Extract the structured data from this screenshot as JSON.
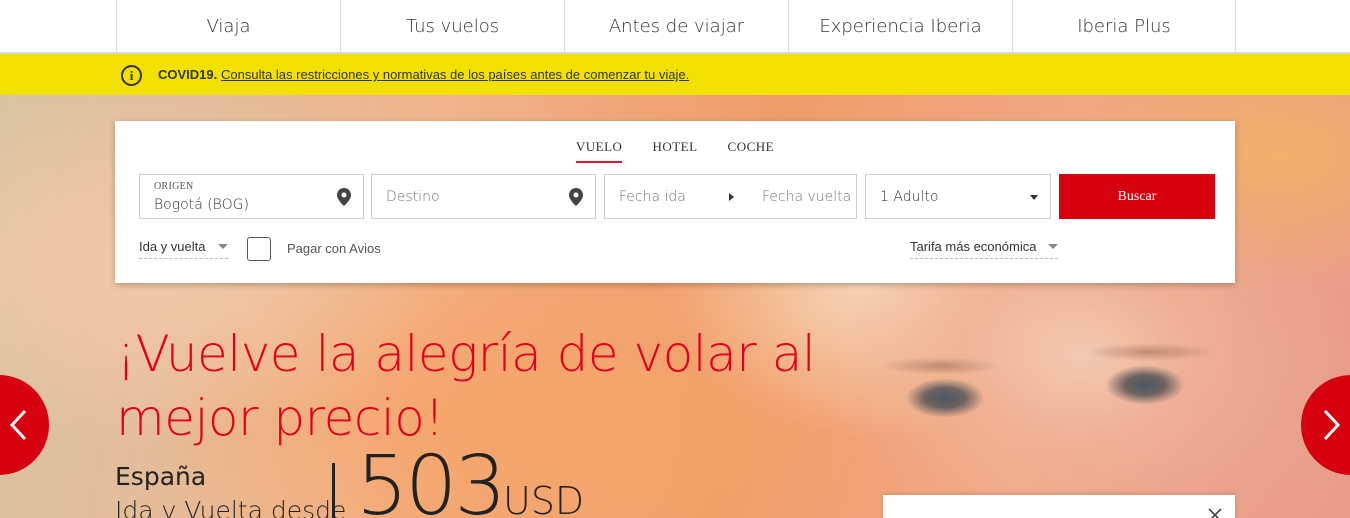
{
  "nav": {
    "items": [
      {
        "label": "Viaja"
      },
      {
        "label": "Tus vuelos"
      },
      {
        "label": "Antes de viajar"
      },
      {
        "label": "Experiencia Iberia"
      },
      {
        "label": "Iberia Plus"
      }
    ]
  },
  "covid": {
    "label": "COVID19.",
    "link": "Consulta las restricciones y normativas de los países antes de comenzar tu viaje.",
    "icon": "info-icon"
  },
  "search": {
    "tabs": [
      {
        "label": "VUELO",
        "active": true
      },
      {
        "label": "HOTEL",
        "active": false
      },
      {
        "label": "COCHE",
        "active": false
      }
    ],
    "origin": {
      "label": "ORIGEN",
      "value": "Bogotá (BOG)"
    },
    "destination": {
      "placeholder": "Destino"
    },
    "dates": {
      "departure_placeholder": "Fecha ida",
      "return_placeholder": "Fecha vuelta"
    },
    "passengers": {
      "value": "1 Adulto"
    },
    "search_button": "Buscar",
    "trip_type": "Ida y vuelta",
    "avios_label": "Pagar con Avios",
    "fare": "Tarifa más económica"
  },
  "hero": {
    "headline": "¡Vuelve la alegría de volar al mejor precio!",
    "destination": "España",
    "subtitle": "Ida y Vuelta desde",
    "price": "503",
    "currency": "USD"
  },
  "colors": {
    "brand_red": "#d7000f",
    "banner_yellow": "#f2e100"
  }
}
